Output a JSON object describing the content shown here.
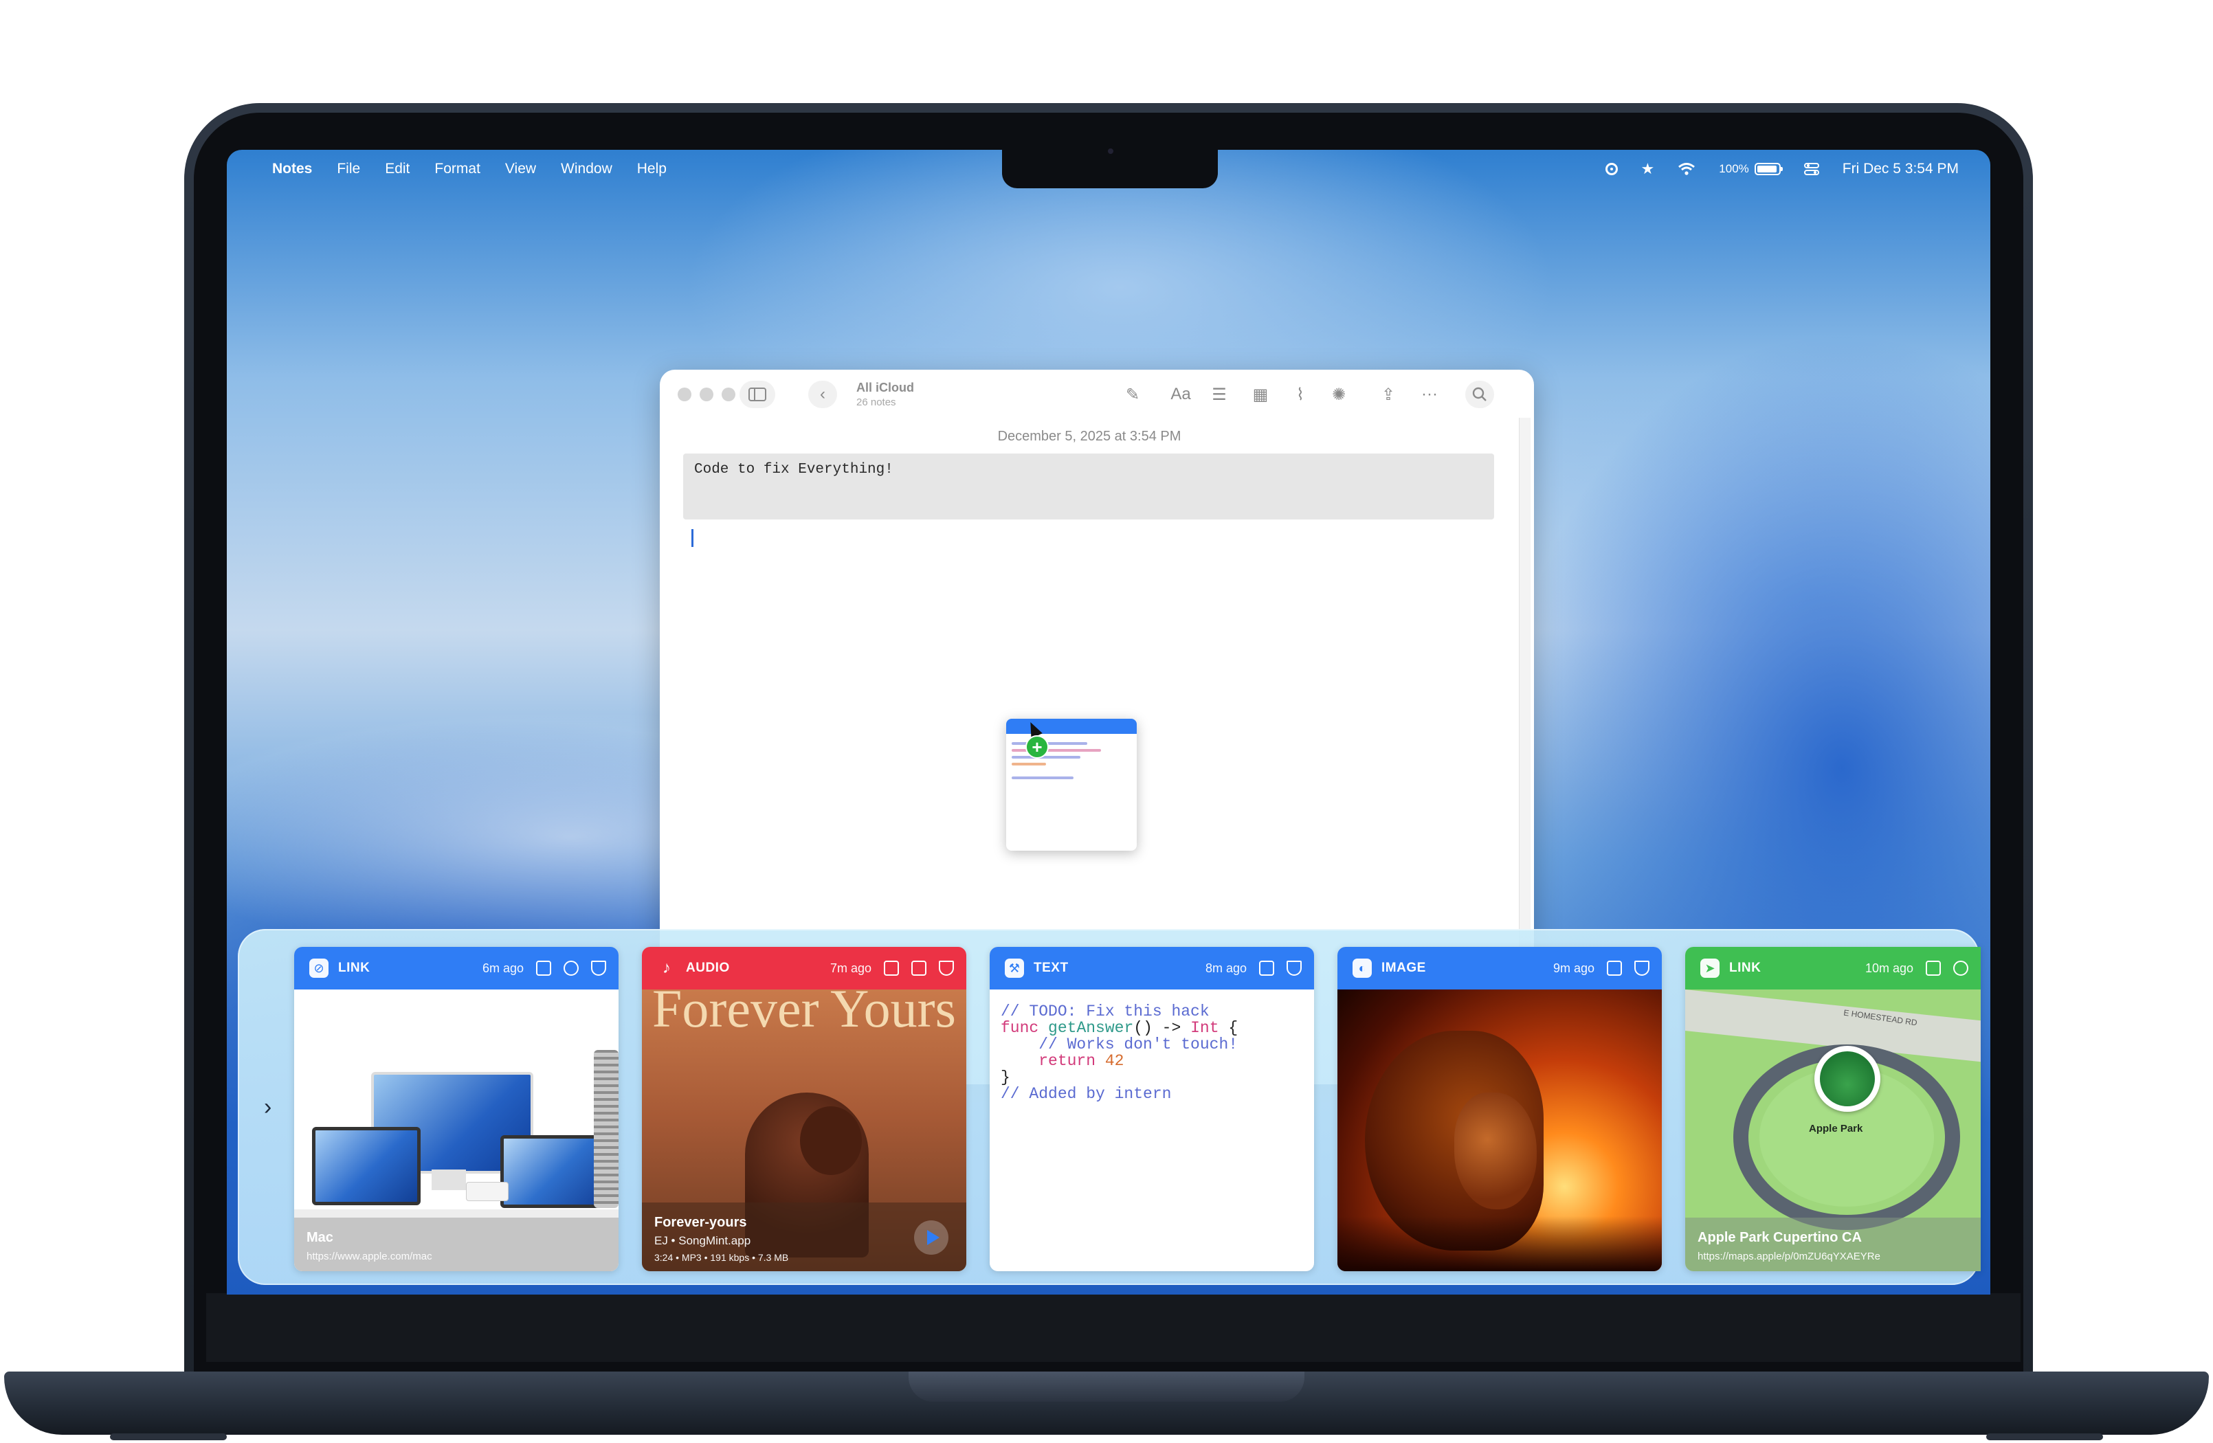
{
  "menubar": {
    "apple_glyph": "",
    "app_name": "Notes",
    "menus": [
      "File",
      "Edit",
      "Format",
      "View",
      "Window",
      "Help"
    ],
    "battery_percent": "100%",
    "datetime": "Fri Dec 5  3:54 PM"
  },
  "notes": {
    "account_title": "All iCloud",
    "account_subtitle": "26 notes",
    "note_date": "December 5, 2025 at 3:54 PM",
    "code_block_text": "Code to fix Everything!",
    "toolbar_aa": "Aa"
  },
  "clipboard": {
    "cards": [
      {
        "type": "LINK",
        "time": "6m ago",
        "title": "Mac",
        "subtitle": "https://www.apple.com/mac",
        "color": "#2f7df5"
      },
      {
        "type": "AUDIO",
        "time": "7m ago",
        "art_title": "Forever Yours",
        "title": "Forever-yours",
        "subtitle": "EJ • SongMint.app",
        "detail": "3:24 • MP3 • 191 kbps • 7.3 MB",
        "color": "#ec3245"
      },
      {
        "type": "TEXT",
        "time": "8m ago",
        "color": "#2f7df5",
        "code_lines": [
          "// TODO: Fix this hack",
          "func getAnswer() -> Int {",
          "    // Works don't touch!",
          "    return 42",
          "}",
          "// Added by intern"
        ]
      },
      {
        "type": "IMAGE",
        "time": "9m ago",
        "color": "#2f7df5"
      },
      {
        "type": "LINK",
        "time": "10m ago",
        "title": "Apple Park Cupertino CA",
        "subtitle": "https://maps.apple/p/0mZU6qYXAEYRe",
        "map_label": "Apple Park",
        "road_label": "E HOMESTEAD RD",
        "color": "#3fbf52"
      }
    ]
  }
}
